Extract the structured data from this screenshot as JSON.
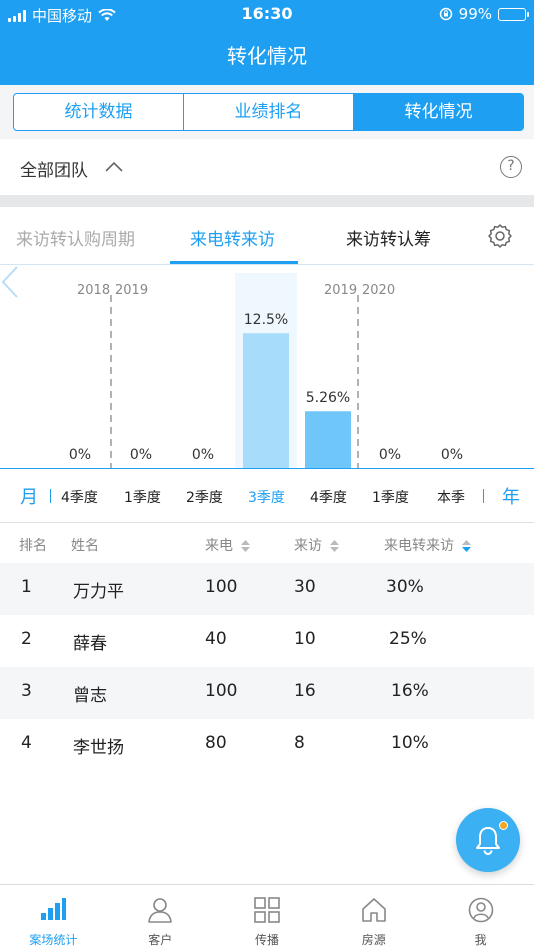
{
  "status_bar": {
    "carrier": "中国移动",
    "time": "16:30",
    "battery": "99%"
  },
  "header": {
    "title": "转化情况"
  },
  "segments": [
    {
      "label": "统计数据",
      "active": false
    },
    {
      "label": "业绩排名",
      "active": false
    },
    {
      "label": "转化情况",
      "active": true
    }
  ],
  "team": {
    "label": "全部团队"
  },
  "sub_tabs": [
    {
      "label": "来访转认购周期",
      "active": false
    },
    {
      "label": "来电转来访",
      "active": true
    },
    {
      "label": "来访转认筹",
      "active": false
    }
  ],
  "chart_data": {
    "type": "bar",
    "categories": [
      "4季度",
      "1季度",
      "2季度",
      "3季度",
      "4季度",
      "1季度",
      "本季"
    ],
    "values": [
      0,
      0,
      0,
      12.5,
      5.26,
      0,
      0
    ],
    "value_labels": [
      "0%",
      "0%",
      "0%",
      "12.5%",
      "5.26%",
      "0%",
      "0%"
    ],
    "year_dividers": [
      {
        "left": "2018",
        "right": "2019"
      },
      {
        "left": "2019",
        "right": "2020"
      }
    ],
    "selected_index": 3,
    "ylim": [
      0,
      14
    ],
    "colors": {
      "selected": "#a8dcfb",
      "normal": "#6fc6f8",
      "highlight_bg": "#eef8fe",
      "divider": "#999999"
    }
  },
  "period": {
    "unit_left": "月",
    "unit_right": "年",
    "items": [
      "4季度",
      "1季度",
      "2季度",
      "3季度",
      "4季度",
      "1季度",
      "本季"
    ],
    "active_index": 3
  },
  "table": {
    "headers": [
      "排名",
      "姓名",
      "来电",
      "来访",
      "来电转来访"
    ],
    "rows": [
      {
        "rank": "1",
        "name": "万力平",
        "calls": "100",
        "visits": "30",
        "rate": "30%"
      },
      {
        "rank": "2",
        "name": "薛春",
        "calls": "40",
        "visits": "10",
        "rate": "25%"
      },
      {
        "rank": "3",
        "name": "曾志",
        "calls": "100",
        "visits": "16",
        "rate": "16%"
      },
      {
        "rank": "4",
        "name": "李世扬",
        "calls": "80",
        "visits": "8",
        "rate": "10%"
      }
    ]
  },
  "tabbar": [
    {
      "label": "案场统计",
      "icon": "bar-chart-icon",
      "active": true
    },
    {
      "label": "客户",
      "icon": "user-icon",
      "active": false
    },
    {
      "label": "传播",
      "icon": "grid-icon",
      "active": false
    },
    {
      "label": "房源",
      "icon": "home-icon",
      "active": false
    },
    {
      "label": "我",
      "icon": "profile-icon",
      "active": false
    }
  ],
  "colors": {
    "brand": "#1e9ff2",
    "badge": "#f5a623"
  }
}
